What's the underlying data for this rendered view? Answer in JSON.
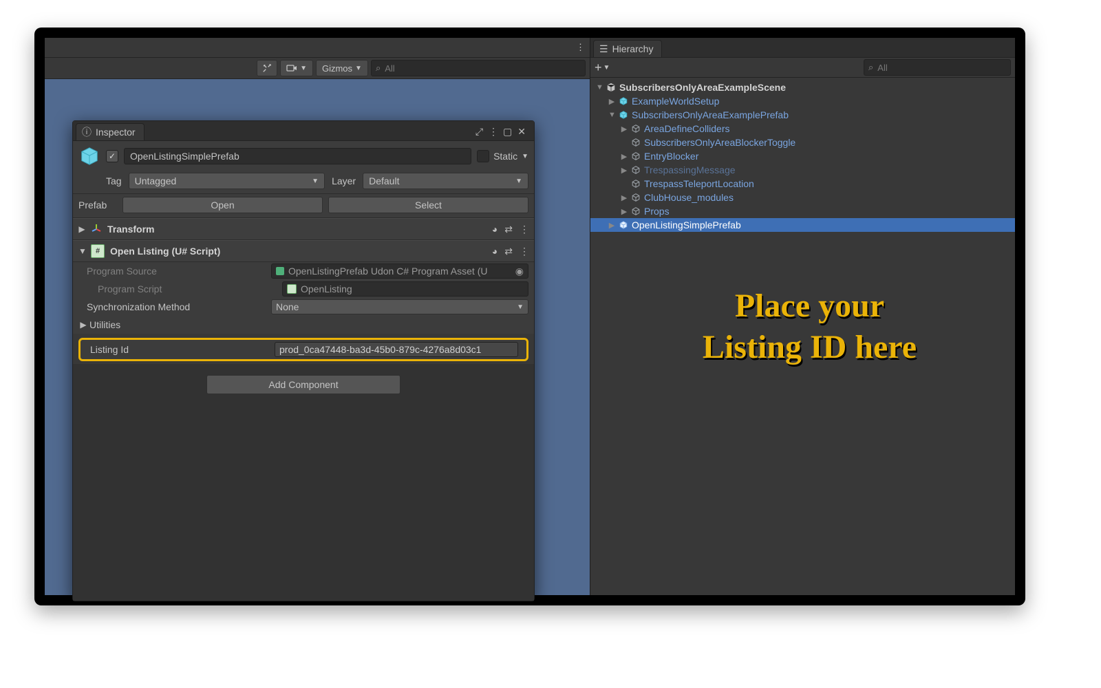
{
  "toolbar": {
    "gizmos_label": "Gizmos",
    "search_placeholder": "All"
  },
  "inspector": {
    "tab_label": "Inspector",
    "object_name": "OpenListingSimplePrefab",
    "static_label": "Static",
    "tag_label": "Tag",
    "tag_value": "Untagged",
    "layer_label": "Layer",
    "layer_value": "Default",
    "prefab_label": "Prefab",
    "open_btn": "Open",
    "select_btn": "Select",
    "transform_title": "Transform",
    "script_title": "Open Listing (U# Script)",
    "prog_source_label": "Program Source",
    "prog_source_value": "OpenListingPrefab Udon C# Program Asset (U",
    "prog_script_label": "Program Script",
    "prog_script_value": "OpenListing",
    "sync_label": "Synchronization Method",
    "sync_value": "None",
    "utilities_label": "Utilities",
    "listing_id_label": "Listing Id",
    "listing_id_value": "prod_0ca47448-ba3d-45b0-879c-4276a8d03c1",
    "add_component": "Add Component"
  },
  "hierarchy": {
    "tab_label": "Hierarchy",
    "search_placeholder": "All",
    "nodes": [
      {
        "depth": 0,
        "fold": "down",
        "type": "scene",
        "label": "SubscribersOnlyAreaExampleScene"
      },
      {
        "depth": 1,
        "fold": "right",
        "type": "prefab",
        "label": "ExampleWorldSetup"
      },
      {
        "depth": 1,
        "fold": "down",
        "type": "prefab",
        "label": "SubscribersOnlyAreaExamplePrefab"
      },
      {
        "depth": 2,
        "fold": "right",
        "type": "obj",
        "label": "AreaDefineColliders"
      },
      {
        "depth": 2,
        "fold": "none",
        "type": "obj",
        "label": "SubscribersOnlyAreaBlockerToggle"
      },
      {
        "depth": 2,
        "fold": "right",
        "type": "obj",
        "label": "EntryBlocker"
      },
      {
        "depth": 2,
        "fold": "right",
        "type": "obj",
        "label": "TrespassingMessage",
        "dim": true
      },
      {
        "depth": 2,
        "fold": "none",
        "type": "obj",
        "label": "TrespassTeleportLocation"
      },
      {
        "depth": 2,
        "fold": "right",
        "type": "obj",
        "label": "ClubHouse_modules"
      },
      {
        "depth": 2,
        "fold": "right",
        "type": "obj",
        "label": "Props"
      },
      {
        "depth": 1,
        "fold": "right",
        "type": "prefab",
        "label": "OpenListingSimplePrefab",
        "selected": true
      }
    ]
  },
  "callout": "Place your\nListing ID here"
}
